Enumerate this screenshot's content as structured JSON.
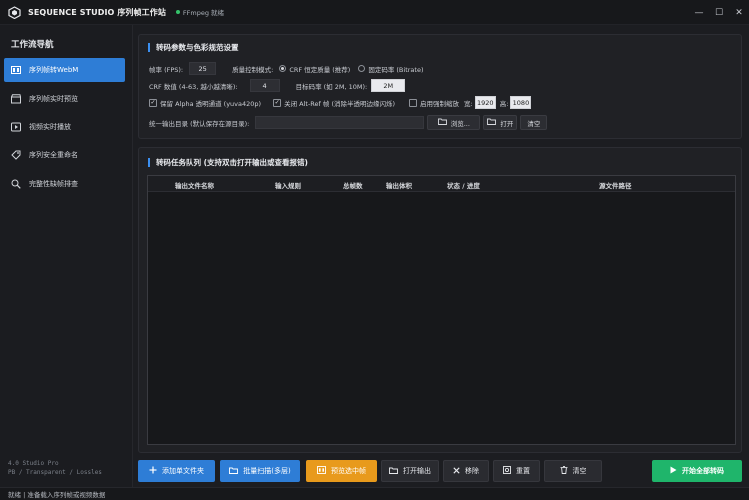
{
  "titlebar": {
    "app_title": "SEQUENCE STUDIO 序列帧工作站",
    "ffmpeg_status": "FFmpeg 就绪",
    "status_color": "#35c26a",
    "minimize": "—",
    "maximize": "☐",
    "close": "✕"
  },
  "sidebar": {
    "heading": "工作流导航",
    "items": [
      {
        "label": "序列帧转WebM",
        "icon": "film-icon",
        "active": true
      },
      {
        "label": "序列帧实时预览",
        "icon": "clapper-icon",
        "active": false
      },
      {
        "label": "视频实时播放",
        "icon": "play-icon",
        "active": false
      },
      {
        "label": "序列安全重命名",
        "icon": "tag-icon",
        "active": false
      },
      {
        "label": "完整性缺帧排查",
        "icon": "search-icon",
        "active": false
      }
    ],
    "version_line1": "4.0 Studio Pro",
    "version_line2": "PB / Transparent / Lossles"
  },
  "settings": {
    "title": "转码参数与色彩规范设置",
    "fps_label": "帧率 (FPS):",
    "fps_value": "25",
    "quality_label": "质量控制模式:",
    "crf_mode": "CRF 恒定质量 (推荐)",
    "bitrate_mode": "固定码率 (Bitrate)",
    "crf_label": "CRF 数值 (4-63, 越小越清晰):",
    "crf_value": "4",
    "bitrate_label": "目标码率 (如 2M, 10M):",
    "bitrate_value": "2M",
    "alpha_label": "保留 Alpha 透明通道 (yuva420p)",
    "altref_label": "关闭 Alt-Ref 帧 (消除半透明边缘闪烁)",
    "scale_label": "启用强制缩放",
    "width_label": "宽:",
    "width_value": "1920",
    "height_label": "高:",
    "height_value": "1080",
    "output_label": "统一输出目录 (默认保存在源目录):",
    "output_value": "",
    "browse": "浏览...",
    "open": "打开",
    "clear": "清空"
  },
  "queue": {
    "title": "转码任务队列 (支持双击打开输出或查看报错)",
    "columns": [
      "输出文件名称",
      "输入规则",
      "总帧数",
      "输出体积",
      "状态 / 进度",
      "源文件路径"
    ]
  },
  "toolbar": {
    "add_folder": "添加单文件夹",
    "batch_scan": "批量扫描(多层)",
    "preview_frame": "预览选中帧",
    "open_output": "打开输出",
    "remove": "移除",
    "reset": "重置",
    "clear": "清空",
    "start_all": "开始全部转码"
  },
  "statusbar": {
    "text": "就绪 | 准备载入序列帧或视频数据"
  }
}
